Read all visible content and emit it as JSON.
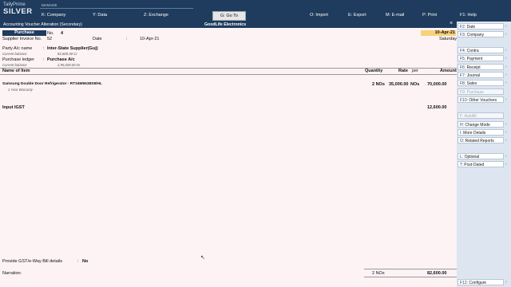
{
  "app": {
    "brand_top": "TallyPrime",
    "brand_edition": "SILVER",
    "manage": "MANAGE"
  },
  "nav": {
    "company": "K: Company",
    "data": "Y: Data",
    "exchange": "Z: Exchange",
    "goto": "G: Go To",
    "import": "O: Import",
    "export": "E: Export",
    "email": "M: E-mail",
    "print": "P: Print",
    "help": "F1: Help"
  },
  "header": {
    "title": "Accounting Voucher Alteration (Secondary)",
    "company": "GoodLife Electronics",
    "close": "×"
  },
  "voucher": {
    "type": "Purchase",
    "no_label": "No.",
    "no": "4",
    "date": "10-Apr-21",
    "day": "Saturday",
    "supplier_invoice_label": "Supplier Invoice No.",
    "supplier_invoice": "52",
    "date_label": "Date",
    "date_sep": ":",
    "invoice_date": "10-Apr-21",
    "party_label": "Party A/c name",
    "party_sep": ":",
    "party": "Inter-State Supplier(Guj)",
    "party_balance_label": "Current balance",
    "party_balance": "82,600.00 Cr",
    "ledger_label": "Purchase ledger",
    "ledger_sep": ":",
    "ledger": "Purchase A/c",
    "ledger_balance_label": "Current balance",
    "ledger_balance": "2,95,000.00 Dr"
  },
  "table": {
    "headers": {
      "item": "Name of Item",
      "qty": "Quantity",
      "rate": "Rate",
      "per": "per",
      "amount": "Amount"
    },
    "item_name": "Samsung Double Door Refrigerator - RT34M5538S8/HL",
    "item_desc": "1 Year Warranty",
    "item_qty": "2 NOs",
    "item_rate": "35,000.00",
    "item_per": "NOs",
    "item_amount": "70,000.00",
    "tax_name": "Input IGST",
    "tax_amount": "12,600.00"
  },
  "footer": {
    "eway_label": "Provide GST/e-Way Bill details",
    "eway_sep": ":",
    "eway_value": "No",
    "narration_label": "Narration:",
    "total_qty": "2 NOs",
    "total_amount": "82,600.00"
  },
  "sidebar": {
    "date": "Date",
    "date_k": "F2:",
    "company": "Company",
    "company_k": "F3:",
    "contra": "Contra",
    "contra_k": "F4:",
    "payment": "Payment",
    "payment_k": "F5:",
    "receipt": "Receipt",
    "receipt_k": "F6:",
    "journal": "Journal",
    "journal_k": "F7:",
    "sales": "Sales",
    "sales_k": "F8:",
    "purchase": "Purchase",
    "purchase_k": "F9:",
    "other": "Other Vouchers",
    "other_k": "F10:",
    "autofill": "Autofill",
    "autofill_k": "F:",
    "change_mode": "Change Mode",
    "change_mode_k": "H:",
    "more_details": "More Details",
    "more_details_k": "I:",
    "related_reports": "Related Reports",
    "related_reports_k": "O:",
    "optional": "Optional",
    "optional_k": "L:",
    "post_dated": "Post-Dated",
    "post_dated_k": "T:",
    "configure": "Configure",
    "configure_k": "F12:"
  },
  "colors": {
    "nav_bg": "#1f3b5d",
    "page_bg": "#fdf3f5",
    "date_highlight": "#f6d27a",
    "sidebar_bg": "#dde6f0"
  }
}
